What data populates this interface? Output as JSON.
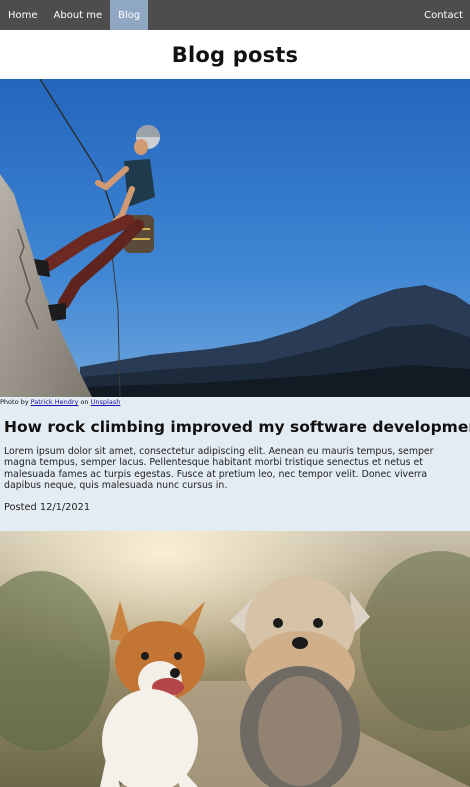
{
  "nav": {
    "home": "Home",
    "about": "About me",
    "blog": "Blog",
    "contact": "Contact"
  },
  "header": {
    "title": "Blog posts"
  },
  "posts": [
    {
      "image": {
        "icon": "rock-climber-photo",
        "credit_prefix": "Photo by",
        "credit_author": "Patrick Hendry",
        "credit_mid": "on",
        "credit_site": "Unsplash"
      },
      "title": "How rock climbing improved my software development skills",
      "excerpt": "Lorem ipsum dolor sit amet, consectetur adipiscing elit. Aenean eu mauris tempus, semper magna tempus, semper lacus. Pellentesque habitant morbi tristique senectus et netus et malesuada fames ac turpis egestas. Fusce at pretium leo, nec tempor velit. Donec viverra dapibus neque, quis malesuada nunc cursus in.",
      "posted": "Posted 12/1/2021"
    },
    {
      "image": {
        "icon": "two-dogs-photo"
      }
    }
  ],
  "colors": {
    "nav_bg": "#4f4c4c",
    "nav_active": "#8fa7c3",
    "card_bg": "#e4ecf3",
    "sky": "#2f74c8"
  }
}
